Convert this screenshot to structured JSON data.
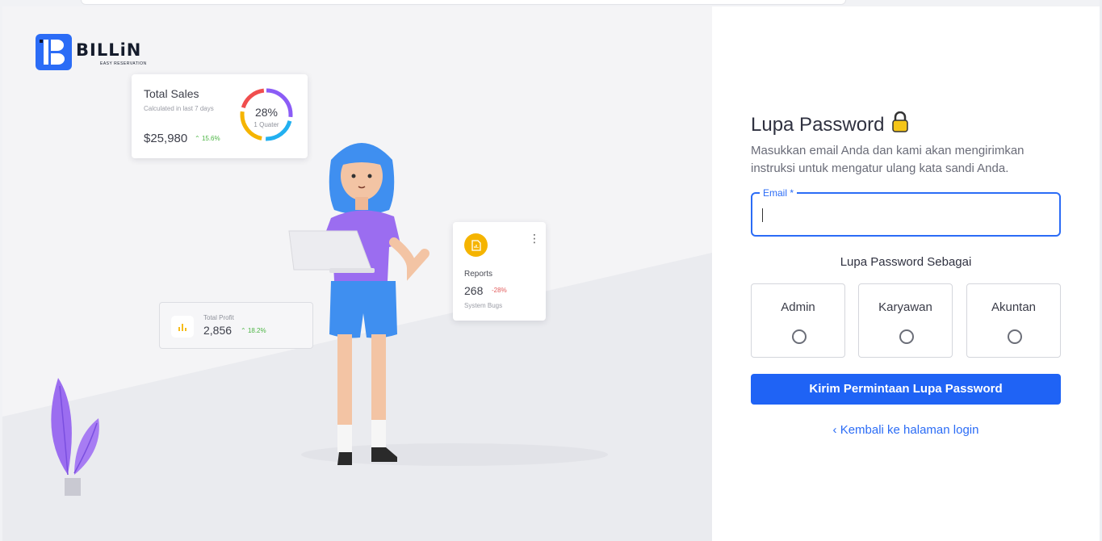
{
  "brand": {
    "name": "BILLiN",
    "tagline": "EASY RESERVATION",
    "color": "#2b6cf6"
  },
  "illustration": {
    "sales_card": {
      "title": "Total Sales",
      "subtitle": "Calculated in last 7 days",
      "value": "$25,980",
      "trend": "15.6%",
      "donut_percent": "28%",
      "donut_label": "1 Quater"
    },
    "reports_card": {
      "title": "Reports",
      "value": "268",
      "trend": "-28%",
      "subtitle": "System Bugs"
    },
    "profit_card": {
      "title": "Total Profit",
      "value": "2,856",
      "trend": "18.2%"
    }
  },
  "form": {
    "title": "Lupa Password",
    "description": "Masukkan email Anda dan kami akan mengirimkan instruksi untuk mengatur ulang kata sandi Anda.",
    "email": {
      "label": "Email *",
      "value": ""
    },
    "role_heading": "Lupa Password Sebagai",
    "roles": [
      {
        "label": "Admin",
        "selected": false
      },
      {
        "label": "Karyawan",
        "selected": false
      },
      {
        "label": "Akuntan",
        "selected": false
      }
    ],
    "submit_label": "Kirim Permintaan Lupa Password",
    "back_label": "Kembali ke halaman login"
  },
  "colors": {
    "primary": "#1f63f5",
    "trend_up": "#4bb543",
    "trend_down": "#e25b5b"
  }
}
